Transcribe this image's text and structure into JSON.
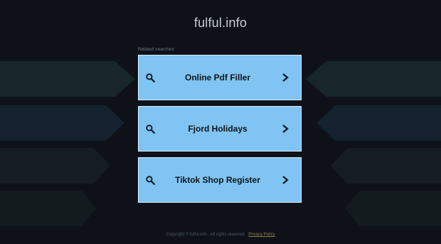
{
  "site": {
    "title": "fulful.info"
  },
  "related": {
    "label": "Related searches",
    "items": [
      {
        "label": "Online Pdf Filler"
      },
      {
        "label": "Fjord Holidays"
      },
      {
        "label": "Tiktok Shop Register"
      }
    ]
  },
  "footer": {
    "copyright": "Copyright © fulful.info . All rights reserved.",
    "privacy_label": "Privacy Policy"
  },
  "colors": {
    "background": "#0e1218",
    "result_bg": "#7fc4f2",
    "band_teal": "#17262a",
    "band_blue": "#152430"
  },
  "icons": {
    "left": "search-icon",
    "right": "chevron-right-icon"
  }
}
